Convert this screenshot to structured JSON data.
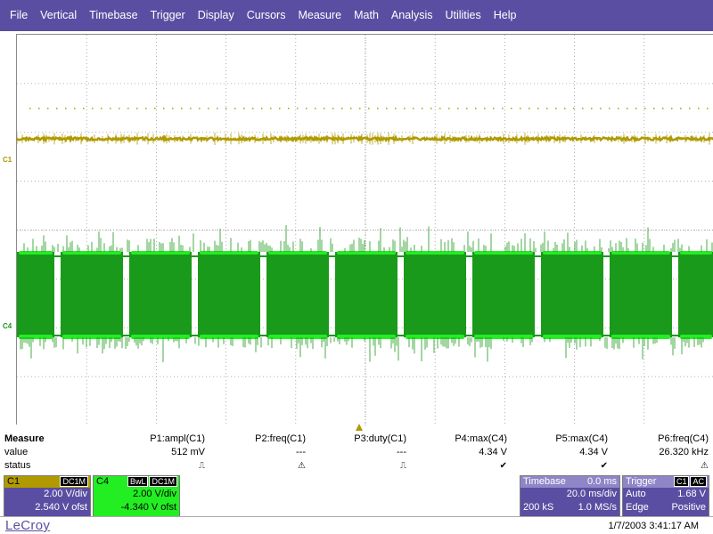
{
  "menu": [
    "File",
    "Vertical",
    "Timebase",
    "Trigger",
    "Display",
    "Cursors",
    "Measure",
    "Math",
    "Analysis",
    "Utilities",
    "Help"
  ],
  "markers": {
    "c1": "C1",
    "c4": "C4"
  },
  "colors": {
    "c1_trace": "#b09a00",
    "c4_trace": "#1a9a1a",
    "c4_bright": "#22ee22",
    "menu_bg": "#5a4ea2"
  },
  "measure": {
    "title": "Measure",
    "row_value_label": "value",
    "row_status_label": "status",
    "params": [
      {
        "label": "P1:ampl(C1)",
        "value": "512 mV",
        "status": "⎍"
      },
      {
        "label": "P2:freq(C1)",
        "value": "---",
        "status": "⚠"
      },
      {
        "label": "P3:duty(C1)",
        "value": "---",
        "status": "⎍"
      },
      {
        "label": "P4:max(C4)",
        "value": "4.34 V",
        "status": "✔"
      },
      {
        "label": "P5:max(C4)",
        "value": "4.34 V",
        "status": "✔"
      },
      {
        "label": "P6:freq(C4)",
        "value": "26.320 kHz",
        "status": "⚠"
      }
    ]
  },
  "channels": {
    "c1": {
      "name": "C1",
      "coupling": "DC1M",
      "vdiv": "2.00 V/div",
      "offset": "2.540 V ofst"
    },
    "c4": {
      "name": "C4",
      "bwl": "BwL",
      "coupling": "DC1M",
      "vdiv": "2.00 V/div",
      "offset": "-4.340 V ofst"
    }
  },
  "timebase": {
    "title": "Timebase",
    "delay": "0.0 ms",
    "tdiv": "20.0 ms/div",
    "samples": "200 kS",
    "rate": "1.0 MS/s"
  },
  "trigger": {
    "title": "Trigger",
    "source": "C1",
    "coupling": "AC",
    "mode": "Auto",
    "level": "1.68 V",
    "type": "Edge",
    "slope": "Positive"
  },
  "footer": {
    "brand": "LeCroy",
    "datetime": "1/7/2003 3:41:17 AM"
  }
}
